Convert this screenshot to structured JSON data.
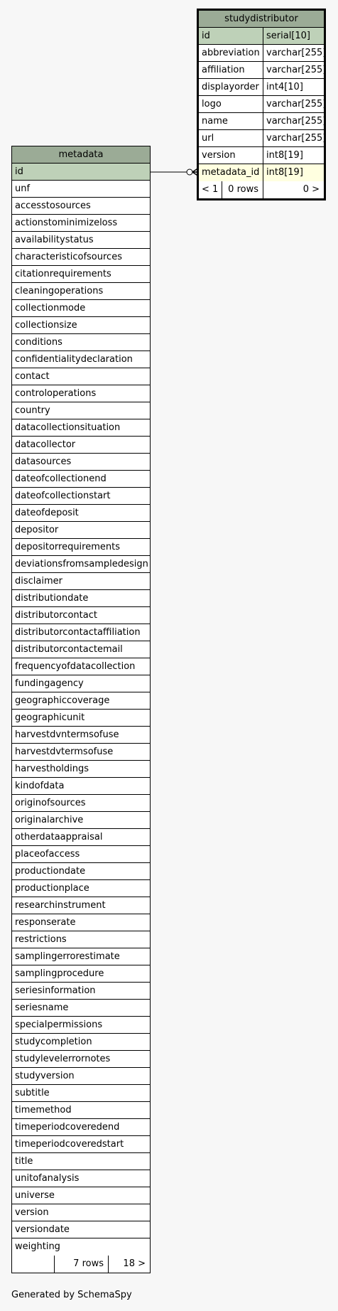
{
  "studydistributor": {
    "title": "studydistributor",
    "columns": [
      {
        "name": "id",
        "type": "serial[10]",
        "key": "pk"
      },
      {
        "name": "abbreviation",
        "type": "varchar[255]",
        "key": ""
      },
      {
        "name": "affiliation",
        "type": "varchar[255]",
        "key": ""
      },
      {
        "name": "displayorder",
        "type": "int4[10]",
        "key": ""
      },
      {
        "name": "logo",
        "type": "varchar[255]",
        "key": ""
      },
      {
        "name": "name",
        "type": "varchar[255]",
        "key": ""
      },
      {
        "name": "url",
        "type": "varchar[255]",
        "key": ""
      },
      {
        "name": "version",
        "type": "int8[19]",
        "key": ""
      },
      {
        "name": "metadata_id",
        "type": "int8[19]",
        "key": "fk"
      }
    ],
    "footer": {
      "left": "< 1",
      "middle": "0 rows",
      "right": "0 >"
    }
  },
  "metadata": {
    "title": "metadata",
    "primary_key": "id",
    "columns": [
      "unf",
      "accesstosources",
      "actionstominimizeloss",
      "availabilitystatus",
      "characteristicofsources",
      "citationrequirements",
      "cleaningoperations",
      "collectionmode",
      "collectionsize",
      "conditions",
      "confidentialitydeclaration",
      "contact",
      "controloperations",
      "country",
      "datacollectionsituation",
      "datacollector",
      "datasources",
      "dateofcollectionend",
      "dateofcollectionstart",
      "dateofdeposit",
      "depositor",
      "depositorrequirements",
      "deviationsfromsampledesign",
      "disclaimer",
      "distributiondate",
      "distributorcontact",
      "distributorcontactaffiliation",
      "distributorcontactemail",
      "frequencyofdatacollection",
      "fundingagency",
      "geographiccoverage",
      "geographicunit",
      "harvestdvntermsofuse",
      "harvestdvtermsofuse",
      "harvestholdings",
      "kindofdata",
      "originofsources",
      "originalarchive",
      "otherdataappraisal",
      "placeofaccess",
      "productiondate",
      "productionplace",
      "researchinstrument",
      "responserate",
      "restrictions",
      "samplingerrorestimate",
      "samplingprocedure",
      "seriesinformation",
      "seriesname",
      "specialpermissions",
      "studycompletion",
      "studylevelerrornotes",
      "studyversion",
      "subtitle",
      "timemethod",
      "timeperiodcoveredend",
      "timeperiodcoveredstart",
      "title",
      "unitofanalysis",
      "universe",
      "version",
      "versiondate",
      "weighting"
    ],
    "footer": {
      "left": "",
      "middle": "7 rows",
      "right": "18 >"
    }
  },
  "generated_by": "Generated by SchemaSpy"
}
